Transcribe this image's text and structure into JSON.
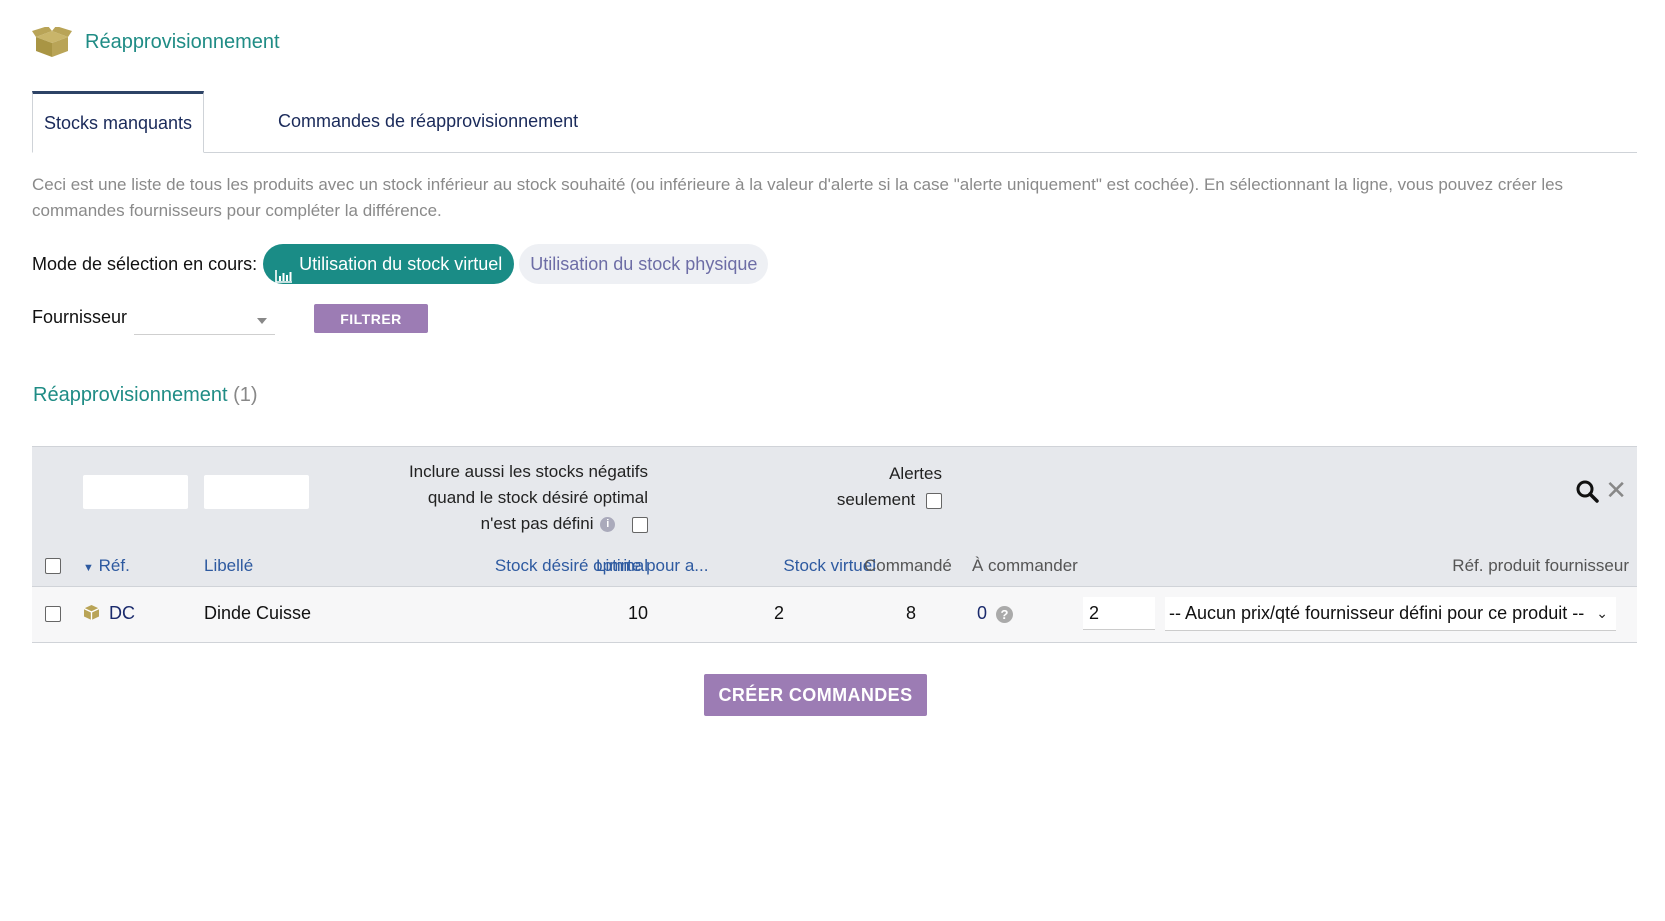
{
  "page": {
    "title": "Réapprovisionnement",
    "title_icon": "box-open-icon"
  },
  "tabs": [
    {
      "label": "Stocks manquants",
      "active": true
    },
    {
      "label": "Commandes de réapprovisionnement",
      "active": false
    }
  ],
  "description": "Ceci est une liste de tous les produits avec un stock inférieur au stock souhaité (ou inférieure à la valeur d'alerte si la case \"alerte uniquement\" est cochée). En sélectionnant la ligne, vous pouvez créer les commandes fournisseurs pour compléter la différence.",
  "mode": {
    "label": "Mode de sélection en cours:",
    "active_option": "Utilisation du stock virtuel",
    "inactive_option": "Utilisation du stock physique",
    "accent_color": "#1a8c86"
  },
  "filter": {
    "supplier_label": "Fournisseur",
    "supplier_value": "",
    "button_label": "FILTRER"
  },
  "section": {
    "title": "Réapprovisionnement",
    "count": "(1)"
  },
  "table": {
    "filters": {
      "include_negative_label_line1": "Inclure aussi les stocks négatifs",
      "include_negative_label_line2": "quand le stock désiré optimal",
      "include_negative_label_line3": "n'est pas défini",
      "alerts_label_line1": "Alertes",
      "alerts_label_line2": "seulement"
    },
    "columns": {
      "ref": "Réf.",
      "label": "Libellé",
      "desired_stock": "Stock désiré optimal",
      "limit": "Limite pour a...",
      "virtual_stock": "Stock virtuel",
      "ordered": "Commandé",
      "to_order": "À commander",
      "supplier_ref": "Réf. produit fournisseur"
    },
    "rows": [
      {
        "ref": "DC",
        "label": "Dinde Cuisse",
        "desired_stock": "10",
        "limit": "2",
        "virtual_stock": "8",
        "ordered": "0",
        "to_order": "2",
        "supplier_ref": "-- Aucun prix/qté fournisseur défini pour ce produit --"
      }
    ]
  },
  "actions": {
    "create_orders": "CRÉER COMMANDES"
  }
}
